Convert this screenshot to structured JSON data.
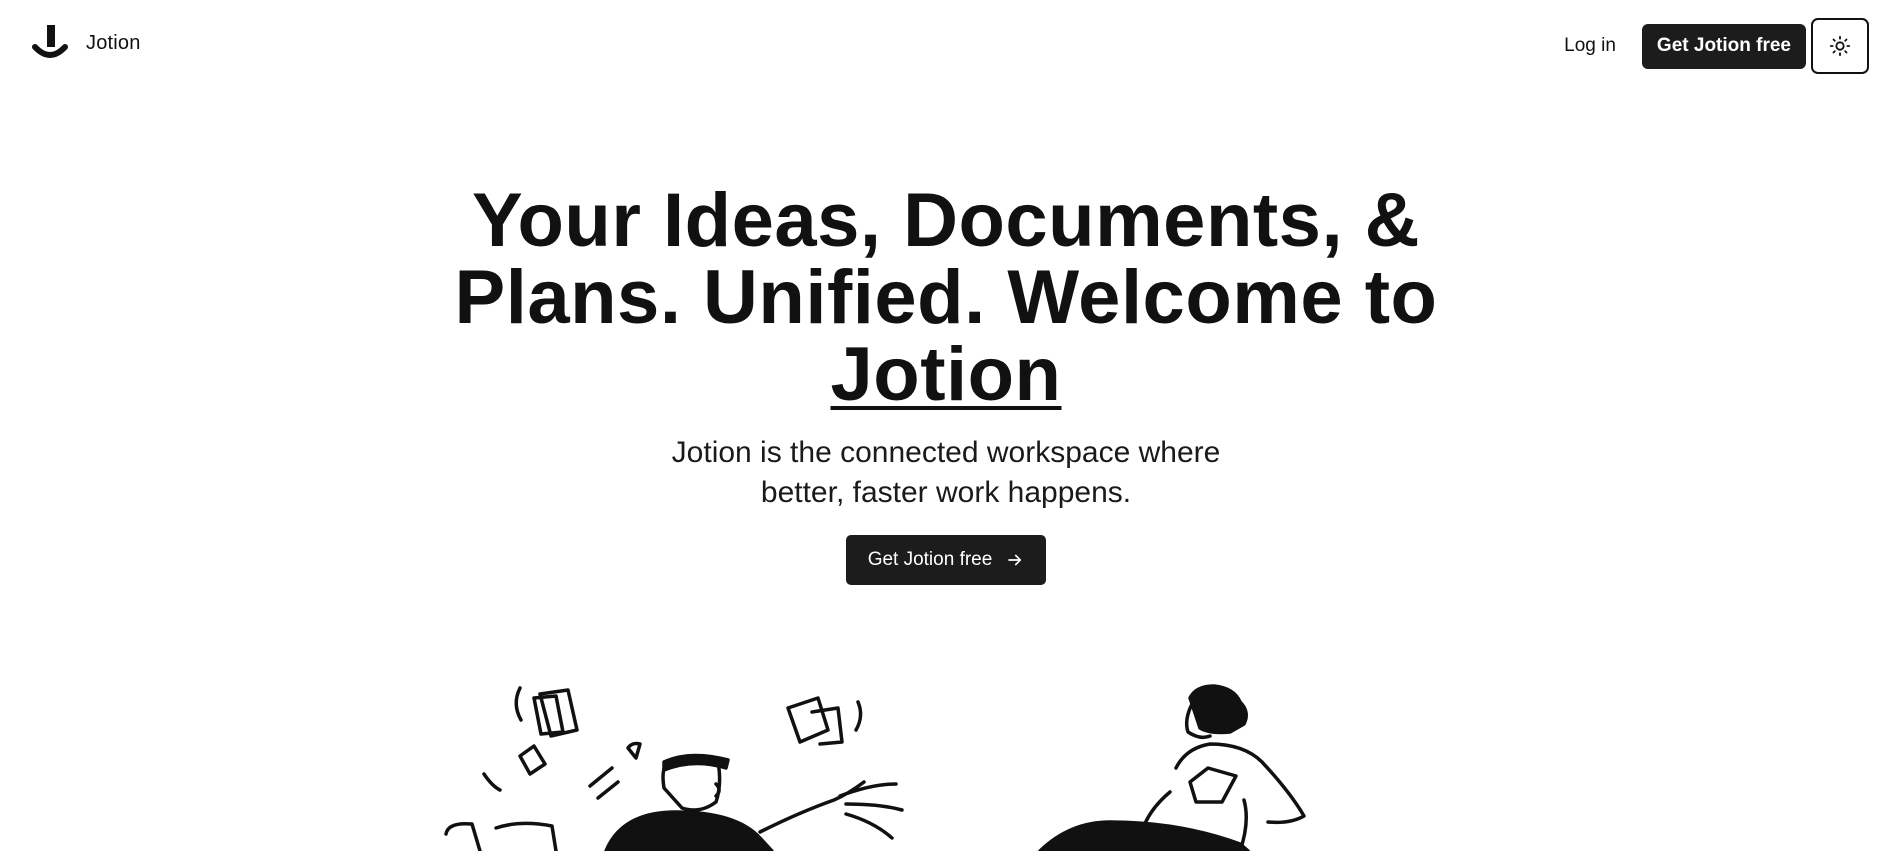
{
  "nav": {
    "brand_name": "Jotion",
    "login_label": "Log in",
    "cta_label": "Get Jotion free",
    "theme_icon": "sun-icon"
  },
  "hero": {
    "headline_lead": "Your Ideas, Documents, & Plans. Unified. Welcome to ",
    "headline_brand": "Jotion",
    "subhead": "Jotion is the connected workspace where better, faster work happens.",
    "cta_label": "Get Jotion free",
    "cta_icon": "arrow-right-icon"
  },
  "colors": {
    "background": "#ffffff",
    "text": "#111111",
    "button": "#1c1c1c",
    "button_text": "#ffffff"
  }
}
